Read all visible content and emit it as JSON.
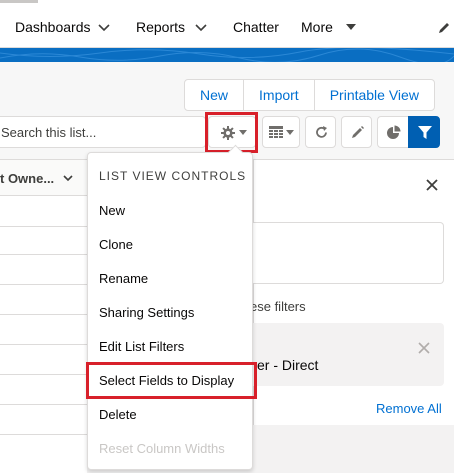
{
  "nav": {
    "items": [
      {
        "label": "Dashboards"
      },
      {
        "label": "Reports"
      },
      {
        "label": "Chatter"
      },
      {
        "label": "More"
      }
    ]
  },
  "header": {
    "buttons": [
      {
        "label": "New"
      },
      {
        "label": "Import"
      },
      {
        "label": "Printable View"
      }
    ],
    "search": {
      "placeholder": "Search this list..."
    }
  },
  "table": {
    "column_header": "t Owne..."
  },
  "dropdown": {
    "title": "LIST VIEW CONTROLS",
    "items": [
      {
        "label": "New"
      },
      {
        "label": "Clone"
      },
      {
        "label": "Rename"
      },
      {
        "label": "Sharing Settings"
      },
      {
        "label": "Edit List Filters"
      },
      {
        "label": "Select Fields to Display"
      },
      {
        "label": "Delete"
      },
      {
        "label": "Reset Column Widths",
        "disabled": true
      }
    ]
  },
  "filters_panel": {
    "hint_text": "ese filters",
    "filter_value": "er - Direct",
    "remove_all": "Remove All"
  },
  "colors": {
    "brand_blue": "#0a6ec2",
    "link_blue": "#0070d2",
    "highlight_red": "#d8202a"
  }
}
